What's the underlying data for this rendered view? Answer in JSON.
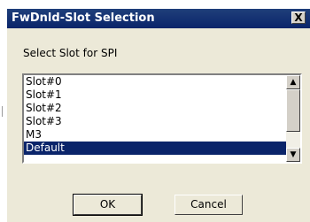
{
  "dialog": {
    "title": "FwDnld-Slot Selection",
    "close_label": "X",
    "prompt": "Select Slot for SPI",
    "list": {
      "items": [
        "Slot#0",
        "Slot#1",
        "Slot#2",
        "Slot#3",
        "M3",
        "Default"
      ],
      "selected": "Default"
    },
    "buttons": {
      "ok": "OK",
      "cancel": "Cancel"
    }
  },
  "icons": {
    "close": "close-icon",
    "scroll_up": "arrow-up-icon",
    "scroll_down": "arrow-down-icon"
  },
  "colors": {
    "titlebar": "#0a246a",
    "selection": "#0a246a",
    "dialog_bg": "#ece9d8"
  }
}
